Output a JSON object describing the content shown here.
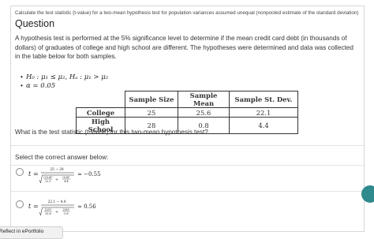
{
  "breadcrumb": "Calculate the test statistic (t-value) for a two-mean hypothesis test for population variances assumed unequal (nonpooled estimate of the standard deviation)",
  "heading": "Question",
  "prompt": "A hypothesis test is performed at the 5% significance level to determine if the mean credit card debt (in thousands of dollars) of graduates of college and high school are different. The hypotheses were determined and data was collected in the table below for both samples.",
  "hypotheses": {
    "h": "H₀ : μ₁ ≤ μ₂, Hₐ : μ₁ > μ₂",
    "alpha": "α = 0.05"
  },
  "table": {
    "headers": [
      "Sample Size",
      "Sample Mean",
      "Sample St. Dev."
    ],
    "rows": [
      {
        "label": "College",
        "cells": [
          "25",
          "25.6",
          "22.1"
        ]
      },
      {
        "label": "High School",
        "cells": [
          "28",
          "0.8",
          "4.4"
        ]
      }
    ]
  },
  "question": "What is the test statistic (t-value) for this two-mean hypothesis test?",
  "select_label": "Select the correct answer below:",
  "options": [
    {
      "t": "t",
      "numerator": "25 − 28",
      "den_a_num": "(25.6)²",
      "den_a_den": "22.1",
      "den_b_num": "(0.8)²",
      "den_b_den": "4.4",
      "result": "≈ −0.55"
    },
    {
      "t": "t",
      "numerator": "22.1 − 4.4",
      "den_a_num": "(25)²",
      "den_a_den": "25.6",
      "den_b_num": "(28)²",
      "den_b_den": "0.8",
      "result": "≈ 0.56"
    }
  ],
  "footer_tab": "Reflect in ePortfolio",
  "colors": {
    "accent": "#2e8a8c",
    "border": "#d8d8d8"
  }
}
